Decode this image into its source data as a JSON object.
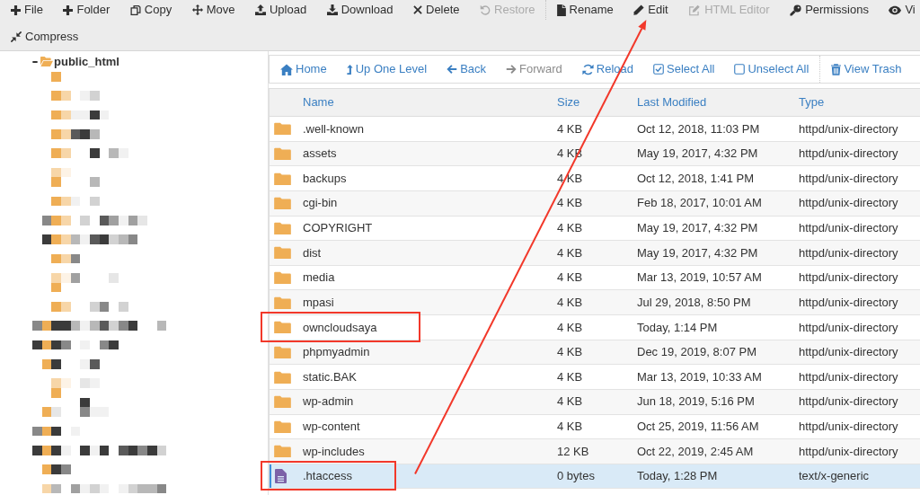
{
  "toolbar": [
    {
      "items": [
        {
          "kind": "button",
          "label": "File",
          "disabled": false,
          "pointed_at": false
        },
        {
          "kind": "button",
          "label": "Folder",
          "disabled": false,
          "pointed_at": false
        },
        {
          "kind": "button",
          "label": "Copy",
          "disabled": false,
          "pointed_at": false
        },
        {
          "kind": "button",
          "label": "Move",
          "disabled": false,
          "pointed_at": false
        },
        {
          "kind": "button",
          "label": "Upload",
          "disabled": false,
          "pointed_at": false
        },
        {
          "kind": "button",
          "label": "Download",
          "disabled": false,
          "pointed_at": false
        },
        {
          "kind": "button",
          "label": "Delete",
          "disabled": false,
          "pointed_at": false
        },
        {
          "kind": "button",
          "label": "Restore",
          "disabled": true,
          "pointed_at": false
        },
        {
          "kind": "separator"
        },
        {
          "kind": "button",
          "label": "Rename",
          "disabled": false,
          "pointed_at": false
        },
        {
          "kind": "button",
          "label": "Edit",
          "disabled": false,
          "pointed_at": true
        },
        {
          "kind": "button",
          "label": "HTML Editor",
          "disabled": true,
          "pointed_at": false
        },
        {
          "kind": "button",
          "label": "Permissions",
          "disabled": false,
          "pointed_at": false
        },
        {
          "kind": "button",
          "label": "Vi",
          "disabled": false,
          "pointed_at": false
        }
      ]
    },
    {
      "items": [
        {
          "kind": "button",
          "label": "Compress",
          "disabled": false,
          "pointed_at": false
        }
      ]
    }
  ],
  "file_tree": {
    "label": "public_html",
    "expanded": true
  },
  "navigation": [
    {
      "kind": "link",
      "label": "Home",
      "disabled": false
    },
    {
      "kind": "link",
      "label": "Up One Level",
      "disabled": false
    },
    {
      "kind": "link",
      "label": "Back",
      "disabled": false
    },
    {
      "kind": "link",
      "label": "Forward",
      "disabled": true
    },
    {
      "kind": "link",
      "label": "Reload",
      "disabled": false
    },
    {
      "kind": "link",
      "label": "Select All",
      "disabled": false
    },
    {
      "kind": "link",
      "label": "Unselect All",
      "disabled": false
    },
    {
      "kind": "separator"
    },
    {
      "kind": "link",
      "label": "View Trash",
      "disabled": false
    }
  ],
  "table": {
    "columns": [
      "Name",
      "Size",
      "Last Modified",
      "Type"
    ],
    "rows": [
      {
        "kind": "folder",
        "name": ".well-known",
        "size": "4 KB",
        "modified": "Oct 12, 2018, 11:03 PM",
        "type": "httpd/unix-directory",
        "selected": false,
        "outlined": false
      },
      {
        "kind": "folder",
        "name": "assets",
        "size": "4 KB",
        "modified": "May 19, 2017, 4:32 PM",
        "type": "httpd/unix-directory",
        "selected": false,
        "outlined": false
      },
      {
        "kind": "folder",
        "name": "backups",
        "size": "4 KB",
        "modified": "Oct 12, 2018, 1:41 PM",
        "type": "httpd/unix-directory",
        "selected": false,
        "outlined": false
      },
      {
        "kind": "folder",
        "name": "cgi-bin",
        "size": "4 KB",
        "modified": "Feb 18, 2017, 10:01 AM",
        "type": "httpd/unix-directory",
        "selected": false,
        "outlined": false
      },
      {
        "kind": "folder",
        "name": "COPYRIGHT",
        "size": "4 KB",
        "modified": "May 19, 2017, 4:32 PM",
        "type": "httpd/unix-directory",
        "selected": false,
        "outlined": false
      },
      {
        "kind": "folder",
        "name": "dist",
        "size": "4 KB",
        "modified": "May 19, 2017, 4:32 PM",
        "type": "httpd/unix-directory",
        "selected": false,
        "outlined": false
      },
      {
        "kind": "folder",
        "name": "media",
        "size": "4 KB",
        "modified": "Mar 13, 2019, 10:57 AM",
        "type": "httpd/unix-directory",
        "selected": false,
        "outlined": false
      },
      {
        "kind": "folder",
        "name": "mpasi",
        "size": "4 KB",
        "modified": "Jul 29, 2018, 8:50 PM",
        "type": "httpd/unix-directory",
        "selected": false,
        "outlined": false
      },
      {
        "kind": "folder",
        "name": "owncloudsaya",
        "size": "4 KB",
        "modified": "Today, 1:14 PM",
        "type": "httpd/unix-directory",
        "selected": false,
        "outlined": true
      },
      {
        "kind": "folder",
        "name": "phpmyadmin",
        "size": "4 KB",
        "modified": "Dec 19, 2019, 8:07 PM",
        "type": "httpd/unix-directory",
        "selected": false,
        "outlined": false
      },
      {
        "kind": "folder",
        "name": "static.BAK",
        "size": "4 KB",
        "modified": "Mar 13, 2019, 10:33 AM",
        "type": "httpd/unix-directory",
        "selected": false,
        "outlined": false
      },
      {
        "kind": "folder",
        "name": "wp-admin",
        "size": "4 KB",
        "modified": "Jun 18, 2019, 5:16 PM",
        "type": "httpd/unix-directory",
        "selected": false,
        "outlined": false
      },
      {
        "kind": "folder",
        "name": "wp-content",
        "size": "4 KB",
        "modified": "Oct 25, 2019, 11:56 AM",
        "type": "httpd/unix-directory",
        "selected": false,
        "outlined": false
      },
      {
        "kind": "folder",
        "name": "wp-includes",
        "size": "12 KB",
        "modified": "Oct 22, 2019, 2:45 AM",
        "type": "httpd/unix-directory",
        "selected": false,
        "outlined": false
      },
      {
        "kind": "file",
        "name": ".htaccess",
        "size": "0 bytes",
        "modified": "Today, 1:28 PM",
        "type": "text/x-generic",
        "selected": true,
        "outlined": true
      }
    ]
  }
}
